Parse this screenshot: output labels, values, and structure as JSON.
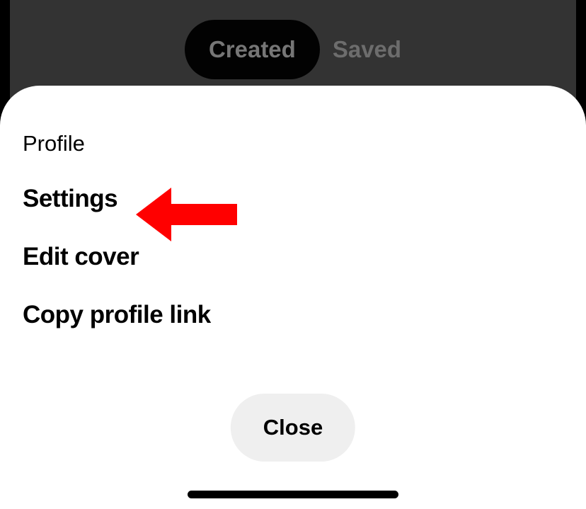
{
  "tabs": {
    "created": "Created",
    "saved": "Saved"
  },
  "sheet": {
    "header": "Profile",
    "items": [
      "Settings",
      "Edit cover",
      "Copy profile link"
    ],
    "close": "Close"
  },
  "annotation": {
    "arrow_color": "#ff0000"
  }
}
